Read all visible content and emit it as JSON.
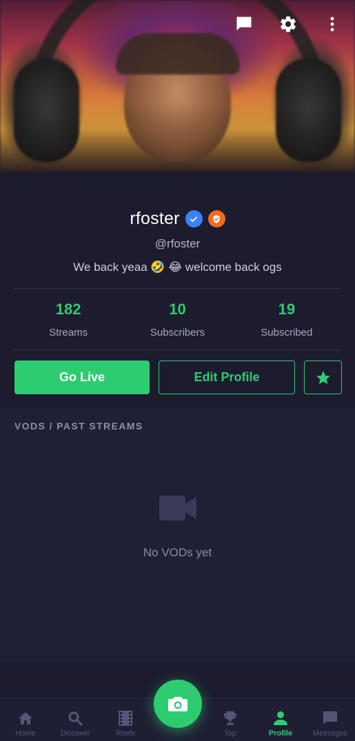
{
  "header": {
    "banner_icon": "profile-banner-image",
    "icons": [
      "chat-icon",
      "gear-icon",
      "more-vertical-icon"
    ]
  },
  "profile": {
    "display_name": "rfoster",
    "handle": "@rfoster",
    "bio": "We back yeaa 🤣 😂 welcome back ogs",
    "badges": [
      "verified-check-icon",
      "shield-check-icon"
    ],
    "stats": [
      {
        "value": "182",
        "label": "Streams"
      },
      {
        "value": "10",
        "label": "Subscribers"
      },
      {
        "value": "19",
        "label": "Subscribed"
      }
    ]
  },
  "actions": {
    "go_live": "Go Live",
    "edit_profile": "Edit Profile",
    "favorite_icon": "star-icon"
  },
  "vods": {
    "title": "VODS / PAST STREAMS",
    "empty_icon": "video-camera-icon",
    "empty_text": "No VODs yet"
  },
  "bottom_nav": {
    "items": [
      {
        "label": "Home",
        "icon": "home-icon"
      },
      {
        "label": "Discover",
        "icon": "search-icon"
      },
      {
        "label": "Reels",
        "icon": "film-icon"
      },
      {
        "label": "Top",
        "icon": "trophy-icon"
      },
      {
        "label": "Profile",
        "icon": "person-icon",
        "active": true
      },
      {
        "label": "Messages",
        "icon": "message-icon"
      }
    ],
    "camera_button_icon": "camera-icon"
  },
  "colors": {
    "accent": "#2ecc71",
    "background": "#1c1c2e",
    "section_background": "#202035",
    "verified_badge": "#3b82f6",
    "shield_badge": "#f26b1d"
  }
}
